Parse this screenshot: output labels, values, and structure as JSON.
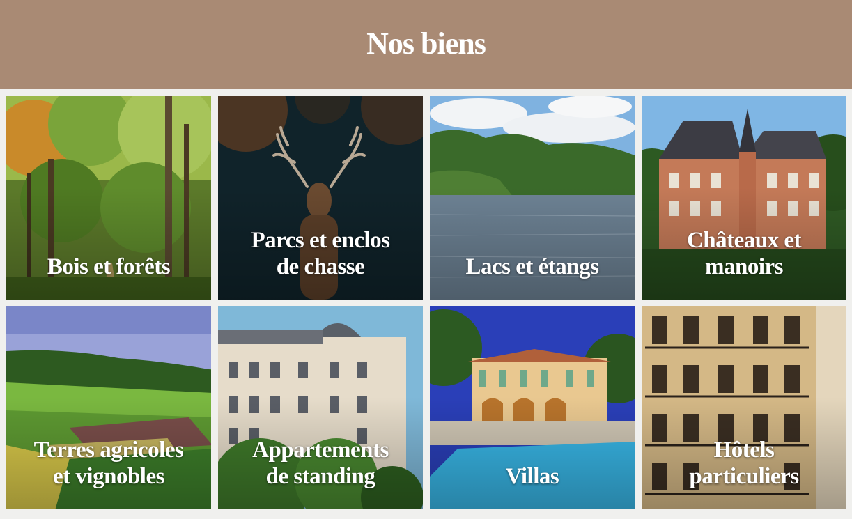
{
  "header": {
    "title": "Nos biens"
  },
  "tiles": [
    {
      "label": "Bois et forêts"
    },
    {
      "label": "Parcs et enclos de chasse"
    },
    {
      "label": "Lacs et étangs"
    },
    {
      "label": "Châteaux et manoirs"
    },
    {
      "label": "Terres agricoles et vignobles"
    },
    {
      "label": "Appartements de standing"
    },
    {
      "label": "Villas"
    },
    {
      "label": "Hôtels particuliers"
    }
  ]
}
